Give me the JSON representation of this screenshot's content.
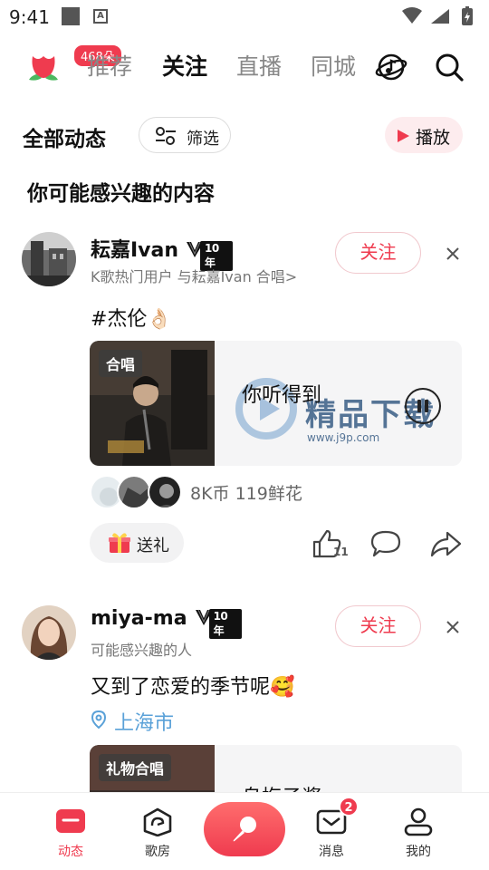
{
  "status_bar": {
    "time": "9:41"
  },
  "top_nav": {
    "flower_badge": "468朵",
    "tabs": [
      {
        "label": "推荐",
        "active": false
      },
      {
        "label": "关注",
        "active": true
      },
      {
        "label": "直播",
        "active": false
      },
      {
        "label": "同城",
        "active": false
      }
    ],
    "icons": [
      "music-planet-icon",
      "search-icon"
    ]
  },
  "feed_header": {
    "title": "全部动态",
    "filter_label": "筛选",
    "play_label": "播放"
  },
  "section_title": "你可能感兴趣的内容",
  "posts": [
    {
      "username": "耘嘉Ivan",
      "vip_years": "10年",
      "subline": "K歌热门用户 与耘嘉Ivan 合唱>",
      "follow_label": "关注",
      "text": "#杰伦👌🏻",
      "song": {
        "tag": "合唱",
        "title": "你听得到",
        "state": "playing"
      },
      "stats": "8K币  119鲜花",
      "gift_label": "送礼",
      "like_count": "11"
    },
    {
      "username": "miya-ma",
      "vip_years": "10年",
      "subline": "可能感兴趣的人",
      "follow_label": "关注",
      "text": "又到了恋爱的季节呢🥰",
      "location": "上海市",
      "song": {
        "tag": "礼物合唱",
        "title": "乌梅子酱"
      }
    }
  ],
  "watermark": {
    "text": "精品下载",
    "url": "www.j9p.com"
  },
  "bottom_nav": [
    {
      "label": "动态",
      "active": true,
      "icon": "feed-icon"
    },
    {
      "label": "歌房",
      "active": false,
      "icon": "room-icon"
    },
    {
      "label": "",
      "active": false,
      "icon": "mic-icon"
    },
    {
      "label": "消息",
      "active": false,
      "icon": "message-icon",
      "badge": "2"
    },
    {
      "label": "我的",
      "active": false,
      "icon": "profile-icon"
    }
  ],
  "colors": {
    "accent": "#ef3b4f",
    "location": "#5aa1d8",
    "muted": "#777777"
  }
}
